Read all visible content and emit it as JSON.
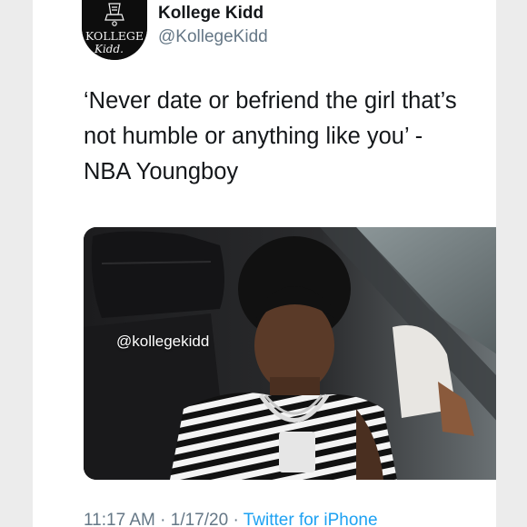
{
  "tweet": {
    "author_name": "Kollege Kidd",
    "author_handle": "@KollegeKidd",
    "avatar_text_top": "KOLLEGE",
    "avatar_text_bottom": "Kidd.",
    "text_lines": [
      "‘Never date or befriend the girl that’s",
      "not humble or anything like you’ -",
      "NBA Youngboy"
    ],
    "media_watermark": "@kollegekidd",
    "time": "11:17 AM",
    "date": "1/17/20",
    "separator": " · ",
    "source": "Twitter for iPhone"
  },
  "icons": {
    "menu": "chevron-down-icon",
    "avatar": "kollege-kidd-logo"
  },
  "colors": {
    "name": "#14171a",
    "secondary": "#657786",
    "link": "#1da1f2",
    "background": "#ffffff"
  }
}
